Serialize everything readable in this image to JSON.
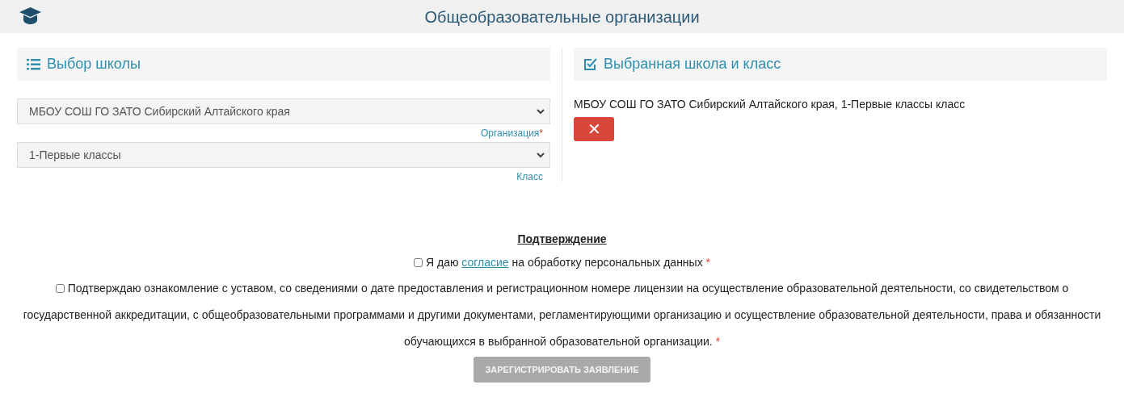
{
  "header": {
    "title": "Общеобразовательные организации"
  },
  "school_choice": {
    "heading": "Выбор школы",
    "fields": [
      {
        "value": "МБОУ СОШ ГО ЗАТО Сибирский Алтайского края",
        "label": "Организация",
        "required_mark": "*"
      },
      {
        "value": "1-Первые классы",
        "label": "Класс"
      }
    ]
  },
  "selected_school": {
    "heading": "Выбранная школа и класс",
    "text": "МБОУ СОШ ГО ЗАТО Сибирский Алтайского края, 1-Первые классы класс",
    "remove_button": "✕"
  },
  "confirmation": {
    "heading": "Подтверждение",
    "items": [
      {
        "before": "Я даю ",
        "link": "согласие",
        "after": " на обработку персональных данных",
        "checked": false,
        "required_mark": "*"
      },
      {
        "before": "Подтверждаю ознакомление с уставом, со сведениями о дате предоставления и регистрационном номере лицензии на осуществление образовательной деятельности, со свидетельством о государственной аккредитации, с общеобразовательными программами и другими документами, регламентирующими организацию и осуществление образовательной деятельности, права и обязанности обучающихся в выбранной образовательной организации.",
        "checked": false,
        "required_mark": "*"
      }
    ],
    "submit": {
      "label": "ЗАРЕГИСТРИРОВАТЬ ЗАЯВЛЕНИЕ",
      "disabled": true
    }
  }
}
